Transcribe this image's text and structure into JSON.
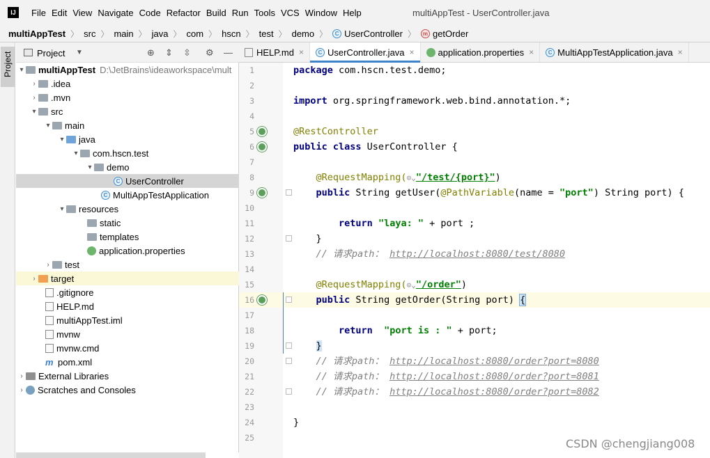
{
  "window": {
    "title": "multiAppTest - UserController.java",
    "logo_text": "IJ"
  },
  "menu": [
    "File",
    "Edit",
    "View",
    "Navigate",
    "Code",
    "Refactor",
    "Build",
    "Run",
    "Tools",
    "VCS",
    "Window",
    "Help"
  ],
  "breadcrumb": [
    "multiAppTest",
    "src",
    "main",
    "java",
    "com",
    "hscn",
    "test",
    "demo",
    "UserController",
    "getOrder"
  ],
  "project_panel": {
    "title": "Project",
    "side_tab": "Project",
    "tree": [
      {
        "label": "multiAppTest",
        "extra": "D:\\JetBrains\\ideaworkspace\\mult"
      },
      {
        "label": ".idea"
      },
      {
        "label": ".mvn"
      },
      {
        "label": "src"
      },
      {
        "label": "main"
      },
      {
        "label": "java"
      },
      {
        "label": "com.hscn.test"
      },
      {
        "label": "demo"
      },
      {
        "label": "UserController"
      },
      {
        "label": "MultiAppTestApplication"
      },
      {
        "label": "resources"
      },
      {
        "label": "static"
      },
      {
        "label": "templates"
      },
      {
        "label": "application.properties"
      },
      {
        "label": "test"
      },
      {
        "label": "target"
      },
      {
        "label": ".gitignore"
      },
      {
        "label": "HELP.md"
      },
      {
        "label": "multiAppTest.iml"
      },
      {
        "label": "mvnw"
      },
      {
        "label": "mvnw.cmd"
      },
      {
        "label": "pom.xml"
      },
      {
        "label": "External Libraries"
      },
      {
        "label": "Scratches and Consoles"
      }
    ]
  },
  "tabs": [
    {
      "label": "HELP.md",
      "close": "×"
    },
    {
      "label": "UserController.java",
      "close": "×"
    },
    {
      "label": "application.properties",
      "close": "×"
    },
    {
      "label": "MultiAppTestApplication.java",
      "close": "×"
    }
  ],
  "line_numbers": [
    "1",
    "2",
    "3",
    "4",
    "5",
    "6",
    "7",
    "8",
    "9",
    "10",
    "11",
    "12",
    "13",
    "14",
    "15",
    "16",
    "17",
    "18",
    "19",
    "20",
    "21",
    "22",
    "23",
    "24",
    "25"
  ],
  "code": {
    "l1_kw": "package",
    "l1_rest": " com.hscn.test.demo;",
    "l3_kw": "import",
    "l3_rest": " org.springframework.web.bind.annotation.*;",
    "l5": "@RestController",
    "l6_kw": "public class",
    "l6_rest": " UserController {",
    "l8_ann": "@RequestMapping(",
    "l8_str": "\"/test/{port}\"",
    "l8_end": ")",
    "l9_kw": "public",
    "l9_a": " String getUser(",
    "l9_ann": "@PathVariable",
    "l9_b": "(name = ",
    "l9_str": "\"port\"",
    "l9_c": ") String port) {",
    "l11_kw": "return",
    "l11_str": " \"laya: \"",
    "l11_rest": " + port ;",
    "l12": "}",
    "l13_cmt": "// 请求path：",
    "l13_url": "http://localhost:8080/test/8080",
    "l15_ann": "@RequestMapping(",
    "l15_str": "\"/order\"",
    "l15_end": ")",
    "l16_kw": "public",
    "l16_rest": " String getOrder(String port) ",
    "l16_brace": "{",
    "l18_kw": "return",
    "l18_str": "  \"port is : \"",
    "l18_rest": " + port;",
    "l19": "}",
    "l20_cmt": "// 请求path：",
    "l20_url": "http://localhost:8080/order?port=8080",
    "l21_cmt": "// 请求path：",
    "l21_url": "http://localhost:8080/order?port=8081",
    "l22_cmt": "// 请求path：",
    "l22_url": "http://localhost:8080/order?port=8082",
    "l24": "}"
  },
  "watermark": "CSDN @chengjiang008"
}
